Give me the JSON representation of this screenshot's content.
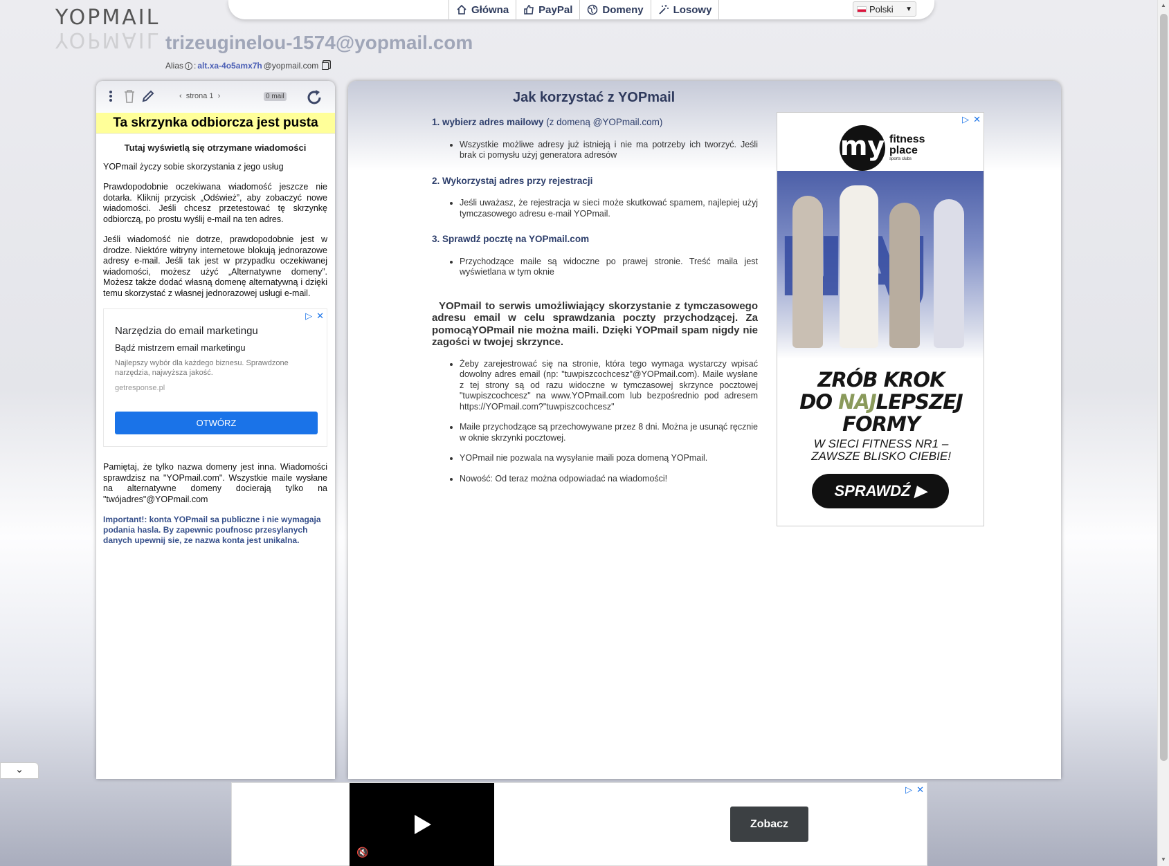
{
  "logo": {
    "text": "YOPMAIL"
  },
  "nav": {
    "items": [
      {
        "label": "Główna",
        "icon": "home-icon"
      },
      {
        "label": "PayPal",
        "icon": "thumbs-up-icon"
      },
      {
        "label": "Domeny",
        "icon": "globe-icon"
      },
      {
        "label": "Losowy",
        "icon": "magic-wand-icon"
      }
    ],
    "language": "Polski"
  },
  "inbox": {
    "email": "trizeuginelou-1574@yopmail.com",
    "alias_label": "Alias",
    "alias_sep": ":",
    "alias_link": "alt.xa-4o5amx7h",
    "alias_domain": "@yopmail.com"
  },
  "left": {
    "page_label": "strona 1",
    "mail_count": "0 mail",
    "empty_banner": "Ta skrzynka odbiorcza jest pusta",
    "subtitle": "Tutaj wyświetlą się otrzymane wiadomości",
    "p1": "YOPmail życzy sobie skorzystania z jego usług",
    "p2": "Prawdopodobnie oczekiwana wiadomość jeszcze nie dotarła. Kliknij przycisk „Odśwież”, aby zobaczyć nowe wiadomości. Jeśli chcesz przetestować tę skrzynkę odbiorczą, po prostu wyślij e-mail na ten adres.",
    "p3": "Jeśli wiadomość nie dotrze, prawdopodobnie jest w drodze. Niektóre witryny internetowe blokują jednorazowe adresy e-mail. Jeśli tak jest w przypadku oczekiwanej wiadomości, możesz użyć „Alternatywne domeny”. Możesz także dodać własną domenę alternatywną i dzięki temu skorzystać z własnej jednorazowej usługi e-mail.",
    "ad": {
      "title": "Narzędzia do email marketingu",
      "headline": "Bądź mistrzem email marketingu",
      "desc": "Najlepszy wybór dla każdego biznesu. Sprawdzone narzędzia, najwyższa jakość.",
      "domain": "getresponse.pl",
      "button": "OTWÓRZ"
    },
    "p4": "Pamiętaj, że tylko nazwa domeny jest inna. Wiadomości sprawdzisz na \"YOPmail.com\". Wszystkie maile wysłane na alternatywne domeny docierają tylko na \"twójadres\"@YOPmail.com",
    "important": "Important!: konta YOPmail sa publiczne i nie wymagaja podania hasla. By zapewnic poufnosc przesylanych danych upewnij sie, ze nazwa konta jest unikalna."
  },
  "right": {
    "title": "Jak korzystać z YOPmail",
    "step1": {
      "title": "1. wybierz adres mailowy",
      "note": " (z domeną @YOPmail.com)",
      "item": "Wszystkie możliwe adresy już istnieją i nie ma potrzeby ich tworzyć. Jeśli brak ci pomysłu użyj generatora adresów"
    },
    "step2": {
      "title": "2. Wykorzystaj adres przy rejestracji",
      "item": "Jeśli uważasz, że rejestracja w sieci może skutkować spamem, najlepiej użyj tymczasowego adresu e-mail YOPmail."
    },
    "step3": {
      "title": "3. Sprawdź pocztę na YOPmail.com",
      "item": "Przychodzące maile są widoczne po prawej stronie. Treść maila jest wyświetlana w tym oknie"
    },
    "intro": "YOPmail to serwis umożliwiający skorzystanie z tymczasowego adresu email w celu sprawdzania poczty przychodzącej. Za pomocąYOPmail nie można maili. Dzięki YOPmail spam nigdy nie zagości w twojej skrzynce.",
    "bullets": [
      "Żeby zarejestrować się na stronie, która tego wymaga wystarczy wpisać dowolny adres email (np: \"tuwpiszcochcesz\"@YOPmail.com). Maile wysłane z tej strony są od razu widoczne w tymczasowej skrzynce pocztowej \"tuwpiszcochcesz\" na www.YOPmail.com lub bezpośrednio pod adresem https://YOPmail.com?\"tuwpiszcochcesz\"",
      "Maile przychodzące są przechowywane przez 8 dni. Można je usunąć ręcznie w oknie skrzynki pocztowej.",
      "YOPmail nie pozwala na wysyłanie maili poza domeną YOPmail.",
      "Nowość: Od teraz można odpowiadać na wiadomości!"
    ],
    "ad": {
      "brand_circle": "my",
      "brand_line1": "fitness",
      "brand_line2": "place",
      "brand_small": "sports clubs",
      "bg_word": "NAJ",
      "headline1": "ZRÓB KROK",
      "headline2a": "DO ",
      "headline2b": "NAJ",
      "headline2c": "LEPSZEJ",
      "headline3": "FORMY",
      "sub1": "W SIECI FITNESS NR1 –",
      "sub2": "ZAWSZE BLISKO CIEBIE!",
      "cta": "SPRAWDŹ ▶"
    }
  },
  "bottom_ad": {
    "button": "Zobacz"
  }
}
